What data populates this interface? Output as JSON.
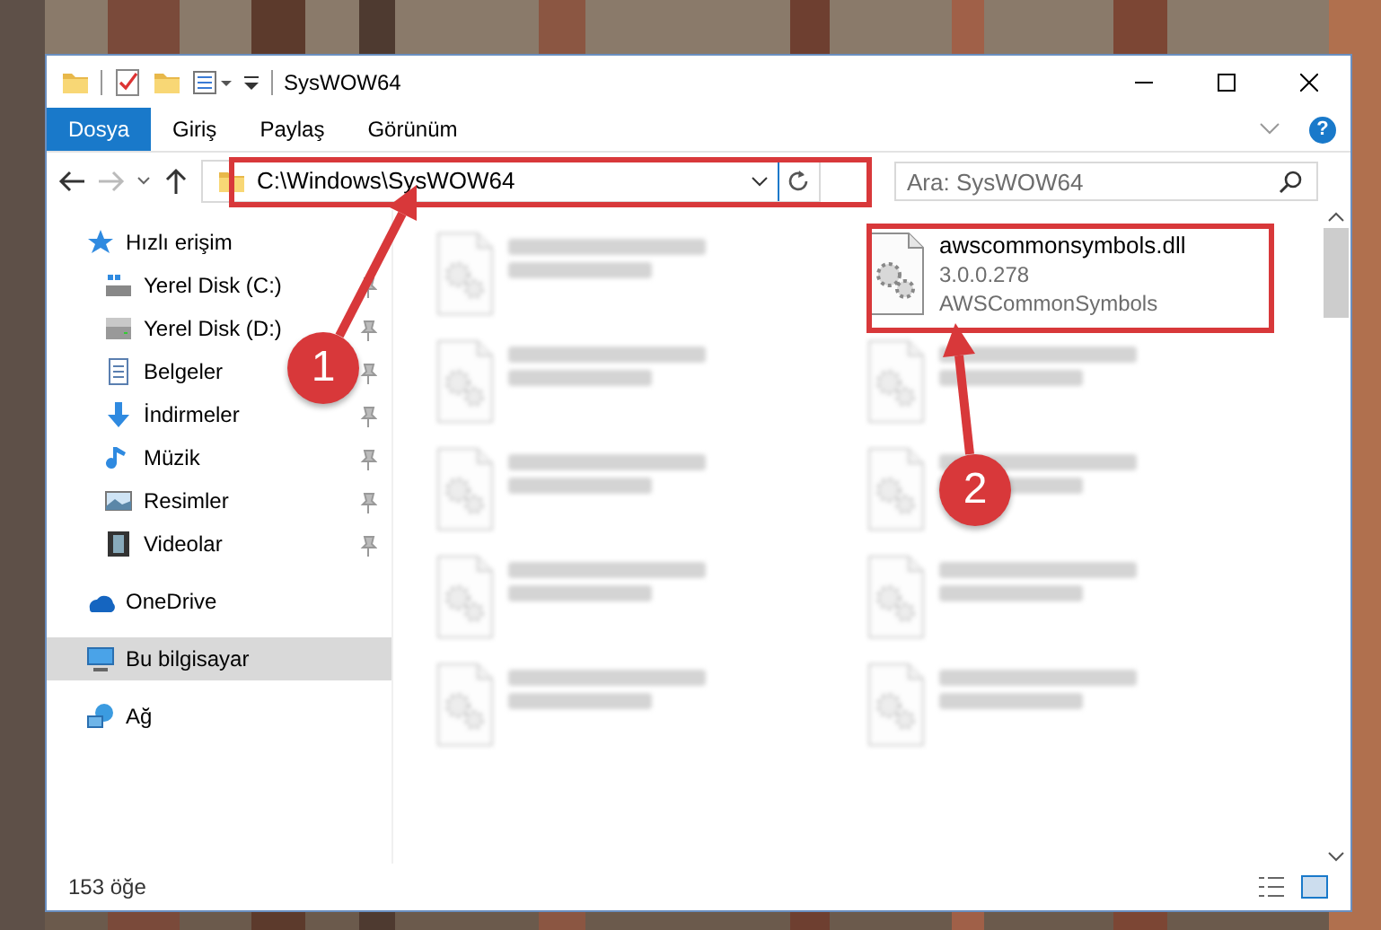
{
  "window": {
    "title": "SysWOW64"
  },
  "ribbon": {
    "tabs": [
      {
        "label": "Dosya",
        "selected": true
      },
      {
        "label": "Giriş",
        "selected": false
      },
      {
        "label": "Paylaş",
        "selected": false
      },
      {
        "label": "Görünüm",
        "selected": false
      }
    ],
    "help": "?"
  },
  "address": {
    "path": "C:\\Windows\\SysWOW64",
    "search_placeholder": "Ara: SysWOW64"
  },
  "sidebar": {
    "items": [
      {
        "label": "Hızlı erişim",
        "selected": false,
        "children": [
          {
            "label": "Yerel Disk (C:)",
            "pinned": true
          },
          {
            "label": "Yerel Disk (D:)",
            "pinned": true
          },
          {
            "label": "Belgeler",
            "pinned": true
          },
          {
            "label": "İndirmeler",
            "pinned": true
          },
          {
            "label": "Müzik",
            "pinned": true
          },
          {
            "label": "Resimler",
            "pinned": true
          },
          {
            "label": "Videolar",
            "pinned": true
          }
        ]
      },
      {
        "label": "OneDrive",
        "selected": false
      },
      {
        "label": "Bu bilgisayar",
        "selected": true
      },
      {
        "label": "Ağ",
        "selected": false
      }
    ]
  },
  "files": [
    {
      "kind": "blurred"
    },
    {
      "kind": "file",
      "name": "awscommonsymbols.dll",
      "details": [
        "3.0.0.278",
        "AWSCommonSymbols"
      ]
    },
    {
      "kind": "blurred"
    },
    {
      "kind": "blurred"
    },
    {
      "kind": "blurred"
    },
    {
      "kind": "blurred"
    },
    {
      "kind": "blurred"
    },
    {
      "kind": "blurred"
    },
    {
      "kind": "blurred"
    },
    {
      "kind": "blurred"
    }
  ],
  "status_bar": {
    "count": "153 öğe"
  },
  "annotations": [
    {
      "label": "1"
    },
    {
      "label": "2"
    }
  ]
}
